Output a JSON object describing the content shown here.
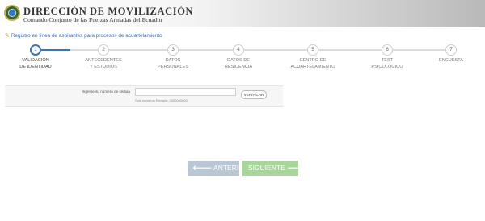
{
  "header": {
    "title": "DIRECCIÓN DE MOVILIZACIÓN",
    "subtitle": "Comando Conjunto de las Fuerzas Armadas del Ecuador",
    "seal_colors": [
      "#2e6b42",
      "#3b73b8",
      "#c9b14a"
    ]
  },
  "registration": {
    "icon": "pencil-icon",
    "text": "Registro en línea de aspirantes para procesos de acuartelamiento"
  },
  "accent_color": "#3a75b4",
  "steps": [
    {
      "number": "1",
      "label": "VALIDACIÓN\nDE IDENTIDAD",
      "active": true
    },
    {
      "number": "2",
      "label": "ANTECEDENTES\nY ESTUDIOS",
      "active": false
    },
    {
      "number": "3",
      "label": "DATOS\nPERSONALES",
      "active": false
    },
    {
      "number": "4",
      "label": "DATOS DE\nRESIDENCIA",
      "active": false
    },
    {
      "number": "5",
      "label": "CENTRO DE\nACUARTELAMIENTO",
      "active": false
    },
    {
      "number": "6",
      "label": "TEST\nPSICOLÓGICO",
      "active": false
    },
    {
      "number": "7",
      "label": "ENCUESTA",
      "active": false
    }
  ],
  "form": {
    "label": "Ingrese su número de cédula",
    "value": "",
    "help": "Solo números Ejemplo: 0000000000",
    "verify_label": "VERIFICAR"
  },
  "nav": {
    "prev_icon": "arrow-left-icon",
    "prev_label": "ANTERIOR",
    "next_label": "SIGUIENTE",
    "next_icon": "arrow-right-icon"
  }
}
